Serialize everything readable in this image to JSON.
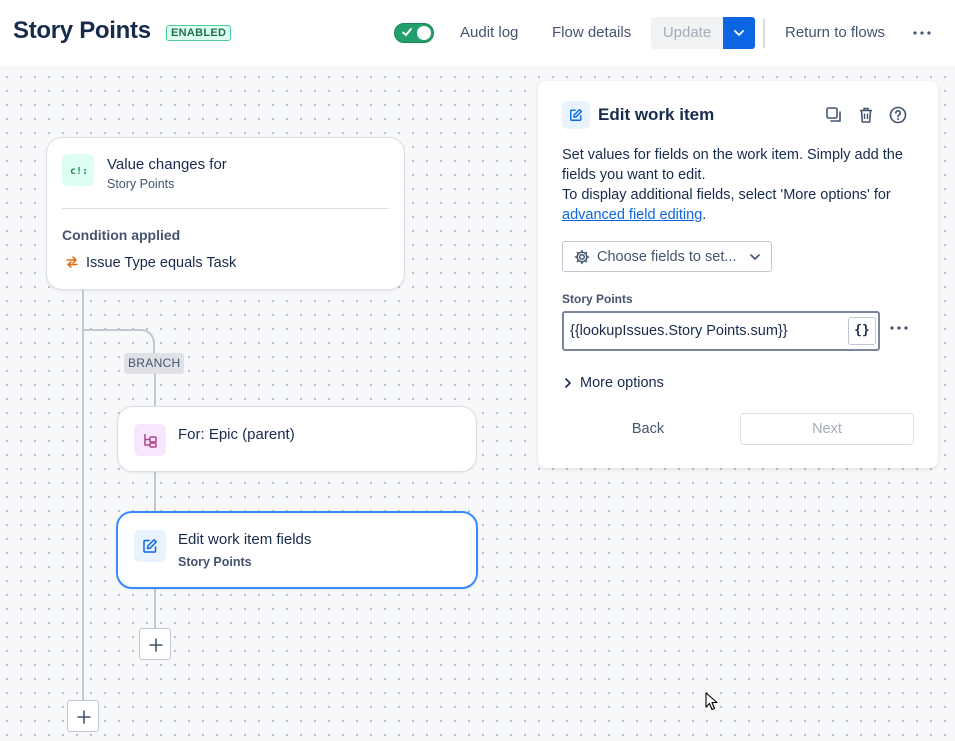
{
  "header": {
    "title": "Story Points",
    "status_badge": "ENABLED",
    "toggle_on": true,
    "audit_log": "Audit log",
    "flow_details": "Flow details",
    "update": "Update",
    "return_to_flows": "Return to flows"
  },
  "canvas": {
    "trigger": {
      "title": "Value changes for",
      "subtitle": "Story Points",
      "condition_heading": "Condition applied",
      "condition_text": "Issue Type equals Task"
    },
    "branch_tag": "BRANCH",
    "branch_node": {
      "title": "For: Epic (parent)"
    },
    "action_node": {
      "title": "Edit work item fields",
      "subtitle": "Story Points"
    }
  },
  "panel": {
    "title": "Edit work item",
    "description_line1": "Set values for fields on the work item. Simply add the fields you want to edit.",
    "description_line2": "To display additional fields, select 'More options' for",
    "description_link": "advanced field editing",
    "description_end": ".",
    "choose_fields": "Choose fields to set...",
    "field_label": "Story Points",
    "field_value": "{{lookupIssues.Story Points.sum}}",
    "braces": "{}",
    "more_options": "More options",
    "back": "Back",
    "next": "Next"
  },
  "colors": {
    "accent": "#0c66e4",
    "toggle": "#22a06b",
    "trigger_icon_bg": "#dcfff1",
    "branch_icon_bg": "#f8e6ff",
    "action_icon_bg": "#e9f2ff"
  }
}
